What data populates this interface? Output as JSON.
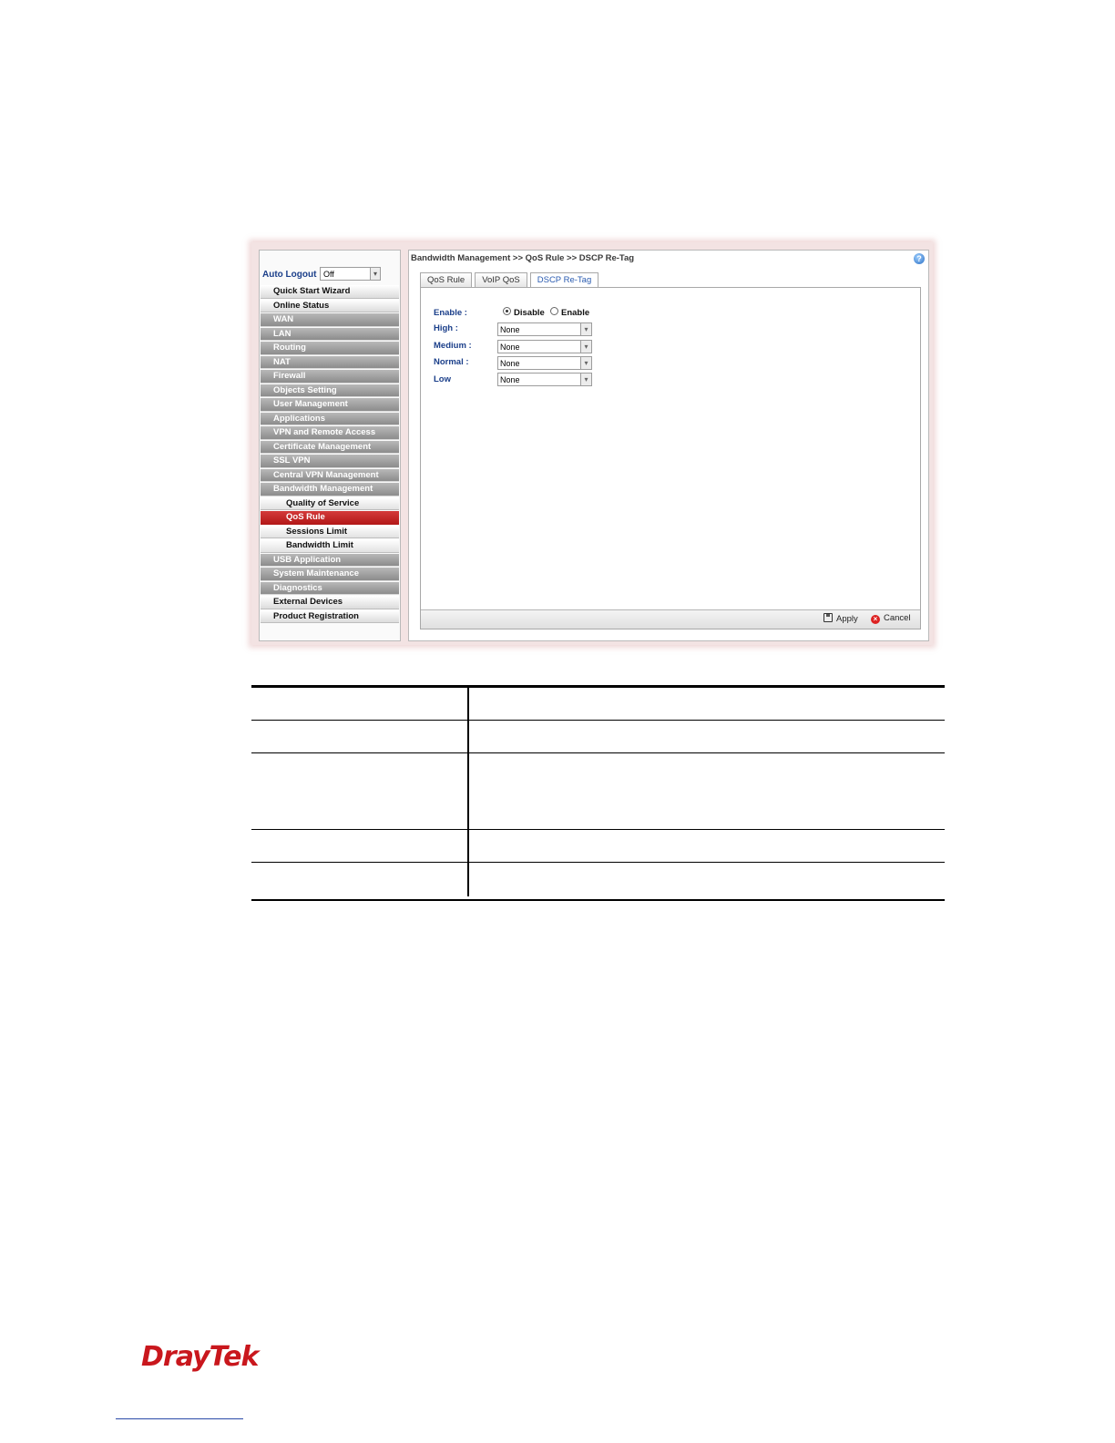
{
  "menu": {
    "auto_logout_label": "Auto Logout :",
    "auto_logout_value": "Off",
    "items": [
      {
        "label": "Quick Start Wizard",
        "style": "light"
      },
      {
        "label": "Online Status",
        "style": "light"
      },
      {
        "label": "WAN",
        "style": "dark"
      },
      {
        "label": "LAN",
        "style": "dark"
      },
      {
        "label": "Routing",
        "style": "dark"
      },
      {
        "label": "NAT",
        "style": "dark"
      },
      {
        "label": "Firewall",
        "style": "dark"
      },
      {
        "label": "Objects Setting",
        "style": "dark"
      },
      {
        "label": "User Management",
        "style": "dark"
      },
      {
        "label": "Applications",
        "style": "dark"
      },
      {
        "label": "VPN and Remote Access",
        "style": "dark"
      },
      {
        "label": "Certificate Management",
        "style": "dark"
      },
      {
        "label": "SSL VPN",
        "style": "dark"
      },
      {
        "label": "Central VPN Management",
        "style": "dark"
      },
      {
        "label": "Bandwidth Management",
        "style": "dark"
      },
      {
        "label": "Quality of Service",
        "style": "sub"
      },
      {
        "label": "QoS Rule",
        "style": "active"
      },
      {
        "label": "Sessions Limit",
        "style": "sub"
      },
      {
        "label": "Bandwidth Limit",
        "style": "sub"
      },
      {
        "label": "USB Application",
        "style": "dark"
      },
      {
        "label": "System Maintenance",
        "style": "dark"
      },
      {
        "label": "Diagnostics",
        "style": "dark"
      },
      {
        "label": "External Devices",
        "style": "light"
      },
      {
        "label": "Product Registration",
        "style": "light"
      }
    ]
  },
  "main": {
    "breadcrumb": "Bandwidth Management >> QoS Rule >> DSCP Re-Tag",
    "tabs": [
      "QoS Rule",
      "VoIP QoS",
      "DSCP Re-Tag"
    ],
    "form": {
      "enable_label": "Enable :",
      "disable_option": "Disable",
      "enable_option": "Enable",
      "selected": "Disable",
      "high_label": "High :",
      "high_value": "None",
      "medium_label": "Medium :",
      "medium_value": "None",
      "normal_label": "Normal :",
      "normal_value": "None",
      "low_label": "Low",
      "low_value": "None"
    },
    "apply_label": "Apply",
    "cancel_label": "Cancel"
  },
  "footer": {
    "logo_text": "DrayTek"
  },
  "colors": {
    "accent_red": "#c9171d",
    "label_blue": "#1b3f8a",
    "menu_dark": "#9a9a9a"
  }
}
